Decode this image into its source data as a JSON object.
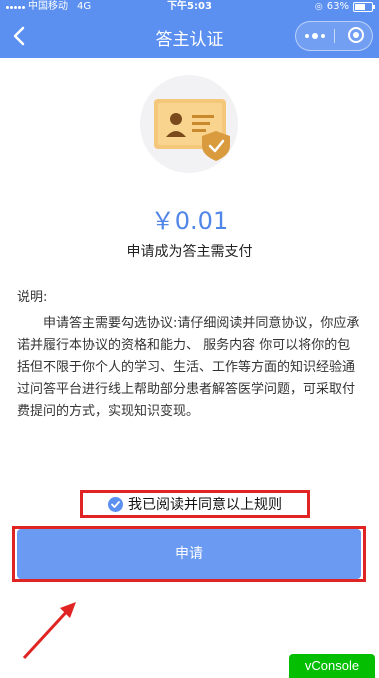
{
  "status_bar": {
    "carrier": "中国移动",
    "network": "4G",
    "time": "下午5:03",
    "battery": "63%"
  },
  "navbar": {
    "title": "答主认证",
    "back_icon": "chevron-left-icon",
    "more_icon": "more-dots-icon",
    "close_icon": "target-circle-icon"
  },
  "hero": {
    "icon": "id-card-shield-icon",
    "colors": {
      "card": "#f5c77a",
      "shield": "#d99b3e",
      "circle": "#f2f2f4"
    }
  },
  "payment": {
    "price": "￥0.01",
    "note": "申请成为答主需支付"
  },
  "description": {
    "label": "说明:",
    "text": "申请答主需要勾选协议:请仔细阅读并同意协议，你应承诺并履行本协议的资格和能力、 服务内容 你可以将你的包括但不限于你个人的学习、生活、工作等方面的知识经验通过问答平台进行线上帮助部分患者解答医学问题，可采取付费提问的方式，实现知识变现。"
  },
  "agreement": {
    "label": "我已阅读并同意以上规则",
    "checked": true
  },
  "apply_button": {
    "label": "申请"
  },
  "vconsole": {
    "label": "vConsole"
  },
  "colors": {
    "primary": "#5b8ff0",
    "button": "#6a9af2",
    "highlight": "#e02424",
    "price": "#4f86e8",
    "vconsole": "#04be02"
  }
}
